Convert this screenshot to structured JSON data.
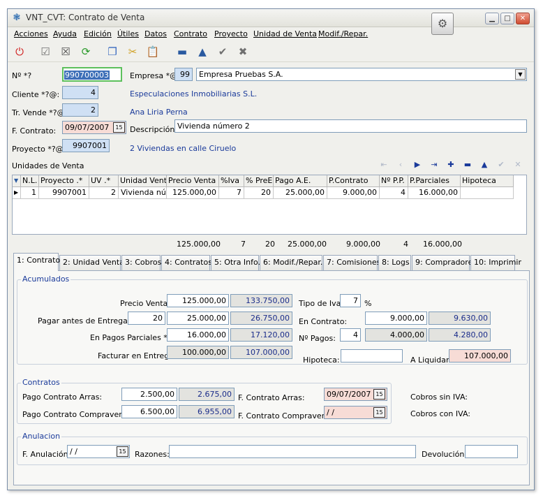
{
  "window": {
    "title": "VNT_CVT: Contrato de Venta"
  },
  "menu": [
    "Acciones",
    "Ayuda",
    "Edición",
    "Útiles",
    "Datos",
    "Contrato",
    "Proyecto",
    "Unidad de Venta",
    "Modif./Repar."
  ],
  "header": {
    "num_label": "Nº *?",
    "num_value": "990700003",
    "empresa_label": "Empresa *@:",
    "empresa_code": "99",
    "empresa_name": "Empresa Pruebas S.A.",
    "cliente_label": "Cliente *?@:",
    "cliente_code": "4",
    "cliente_name": "Especulaciones Inmobiliarias S.L.",
    "vende_label": "Tr. Vende *?@",
    "vende_code": "2",
    "vende_name": "Ana Liria Perna",
    "fcontrato_label": "F. Contrato:",
    "fcontrato_value": "09/07/2007",
    "descripcion_label": "Descripción:",
    "descripcion_value": "Vivienda número 2",
    "proyecto_label": "Proyecto *?@",
    "proyecto_code": "9907001",
    "proyecto_name": "2 Viviendas en calle Ciruelo"
  },
  "units": {
    "title": "Unidades de Venta",
    "columns": [
      "N.L.",
      "Proyecto .*",
      "UV .*",
      "Unidad Venta",
      "Precio Venta",
      "%Iva",
      "% PreE.",
      "Pago A.E.",
      "P.Contrato",
      "Nº P.P.",
      "P.Parciales",
      "Hipoteca"
    ],
    "row": [
      "1",
      "9907001",
      "2",
      "Vivienda núm",
      "125.000,00",
      "7",
      "20",
      "25.000,00",
      "9.000,00",
      "4",
      "16.000,00",
      ""
    ],
    "totals": [
      "125.000,00",
      "7",
      "20",
      "25.000,00",
      "9.000,00",
      "4",
      "16.000,00"
    ]
  },
  "tabs": [
    "1: Contrato",
    "2: Unidad Venta",
    "3: Cobros",
    "4: Contratos",
    "5: Otra Info.",
    "6: Modif./Repar.",
    "7: Comisiones",
    "8: Logs",
    "9: Compradores",
    "10: Imprimir"
  ],
  "acumulados": {
    "title": "Acumulados",
    "precio_venta_label": "Precio Venta:",
    "precio_venta": "125.000,00",
    "precio_venta_iva": "133.750,00",
    "pagar_label": "Pagar antes de Entrega *?:",
    "pagar_pct": "20",
    "pagar_value": "25.000,00",
    "pagar_iva": "26.750,00",
    "parciales_label": "En Pagos Parciales *?:",
    "parciales_value": "16.000,00",
    "parciales_iva": "17.120,00",
    "facturar_label": "Facturar en Entrega:",
    "facturar_value": "100.000,00",
    "facturar_iva": "107.000,00",
    "tipo_iva_label": "Tipo de Iva:",
    "tipo_iva": "7",
    "pct_sign": "%",
    "en_contrato_label": "En Contrato:",
    "en_contrato": "9.000,00",
    "en_contrato_iva": "9.630,00",
    "num_pagos_label": "Nº Pagos:",
    "num_pagos": "4",
    "pago_value": "4.000,00",
    "pago_iva": "4.280,00",
    "hipoteca_label": "Hipoteca:",
    "hipoteca_value": "",
    "liquidar_label": "A Liquidar:",
    "liquidar_value": "107.000,00"
  },
  "contratos": {
    "title": "Contratos",
    "arras_label": "Pago Contrato Arras:",
    "arras_value": "2.500,00",
    "arras_iva": "2.675,00",
    "compra_label": "Pago Contrato Compraventa:",
    "compra_value": "6.500,00",
    "compra_iva": "6.955,00",
    "f_arras_label": "F. Contrato Arras:",
    "f_arras": "09/07/2007",
    "f_compra_label": "F. Contrato Compraventa:",
    "f_compra": " / /",
    "cobros_sin_label": "Cobros sin IVA:",
    "cobros_con_label": "Cobros con IVA:"
  },
  "anulacion": {
    "title": "Anulacion",
    "f_label": "F. Anulación:",
    "f_value": " / /",
    "razones_label": "Razones:",
    "razones_value": "",
    "devolucion_label": "Devolución:",
    "devolucion_value": ""
  },
  "colors": {
    "accent": "#1a3a9a",
    "field_blue": "#cfe0f4",
    "field_pink": "#f7dcd6",
    "selection": "#3d6fb8"
  }
}
